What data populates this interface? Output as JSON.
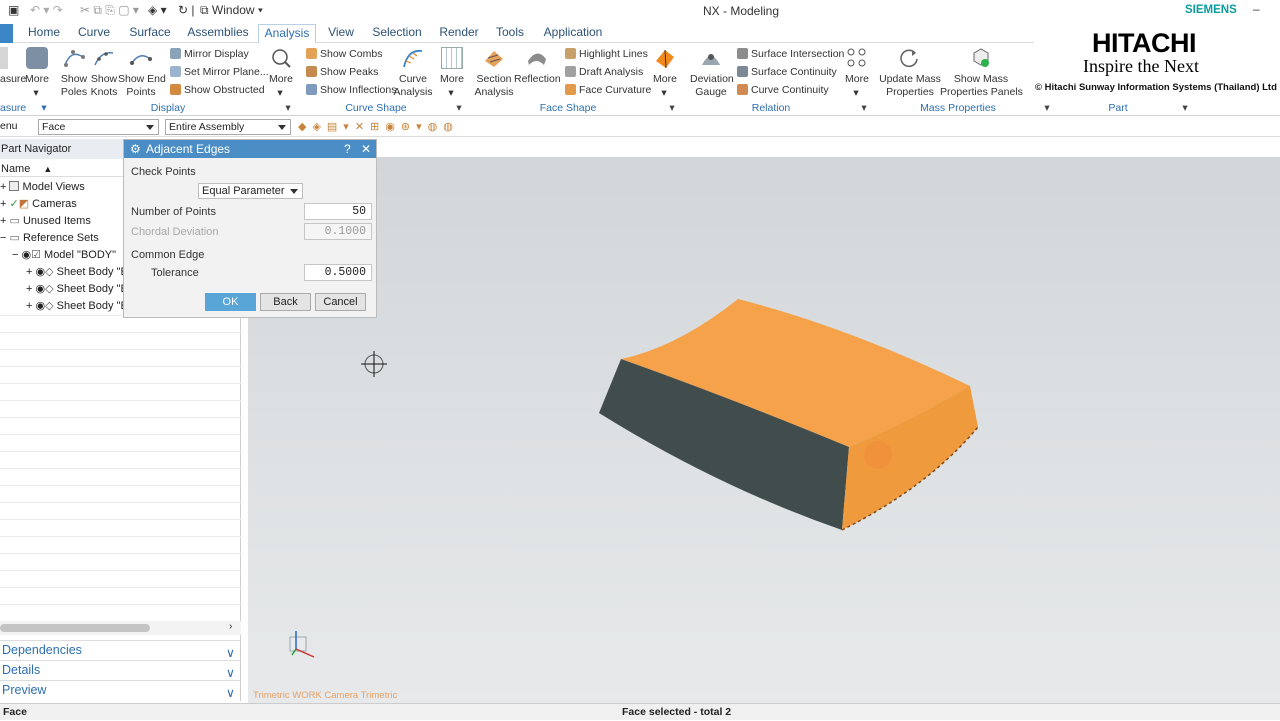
{
  "titlebar": {
    "window_label": "Window",
    "app_title": "NX - Modeling",
    "brand": "SIEMENS"
  },
  "tabs": [
    "Home",
    "Curve",
    "Surface",
    "Assemblies",
    "Analysis",
    "View",
    "Selection",
    "Render",
    "Tools",
    "Application"
  ],
  "active_tab": "Analysis",
  "ribbon": {
    "measure_partial": "asure",
    "measure_group": "asure",
    "more_label": "More",
    "display": {
      "group": "Display",
      "show_poles": "Show\nPoles",
      "show_knots": "Show\nKnots",
      "show_end_points": "Show End\nPoints",
      "mirror_display": "Mirror Display",
      "set_mirror_plane": "Set Mirror Plane...",
      "show_obstructed": "Show Obstructed"
    },
    "curve_shape": {
      "group": "Curve Shape",
      "show_combs": "Show Combs",
      "show_peaks": "Show Peaks",
      "show_inflections": "Show Inflections",
      "curve_analysis": "Curve\nAnalysis"
    },
    "face_shape": {
      "group": "Face Shape",
      "section_analysis": "Section\nAnalysis",
      "reflection": "Reflection",
      "highlight_lines": "Highlight Lines",
      "draft_analysis": "Draft Analysis",
      "face_curvature": "Face Curvature"
    },
    "relation": {
      "group": "Relation",
      "deviation_gauge": "Deviation\nGauge",
      "surface_intersection": "Surface Intersection",
      "surface_continuity": "Surface Continuity",
      "curve_continuity": "Curve Continuity"
    },
    "mass_properties": {
      "group": "Mass Properties",
      "update_mass": "Update Mass\nProperties",
      "show_mass_panels": "Show Mass\nProperties Panels"
    },
    "part": {
      "group": "Part"
    }
  },
  "logo": {
    "name": "HITACHI",
    "tagline": "Inspire the Next",
    "company": "© Hitachi Sunway Information Systems (Thailand) Ltd"
  },
  "filterbar": {
    "menu_partial": "enu",
    "type_filter": "Face",
    "scope_filter": "Entire Assembly"
  },
  "navigator": {
    "title": "Part Navigator",
    "column_name": "Name",
    "items": [
      {
        "label": "Model Views"
      },
      {
        "label": "Cameras"
      },
      {
        "label": "Unused Items"
      },
      {
        "label": "Reference Sets"
      },
      {
        "label": "Model \"BODY\""
      },
      {
        "label": "Sheet Body \"E"
      },
      {
        "label": "Sheet Body \"E"
      },
      {
        "label": "Sheet Body \"E"
      }
    ],
    "panes": [
      "Dependencies",
      "Details",
      "Preview"
    ]
  },
  "dialog": {
    "title": "Adjacent Edges",
    "help": "?",
    "close": "✕",
    "check_points_label": "Check Points",
    "method_value": "Equal Parameter",
    "number_of_points_label": "Number of Points",
    "number_of_points_value": "50",
    "chordal_deviation_label": "Chordal Deviation",
    "chordal_deviation_value": "0.1000",
    "common_edge_label": "Common Edge",
    "tolerance_label": "Tolerance",
    "tolerance_value": "0.5000",
    "ok": "OK",
    "back": "Back",
    "cancel": "Cancel"
  },
  "viewport": {
    "camera_label": "Trimetric WORK Camera Trimetric"
  },
  "statusbar": {
    "left": "Face",
    "center": "Face selected - total 2"
  }
}
